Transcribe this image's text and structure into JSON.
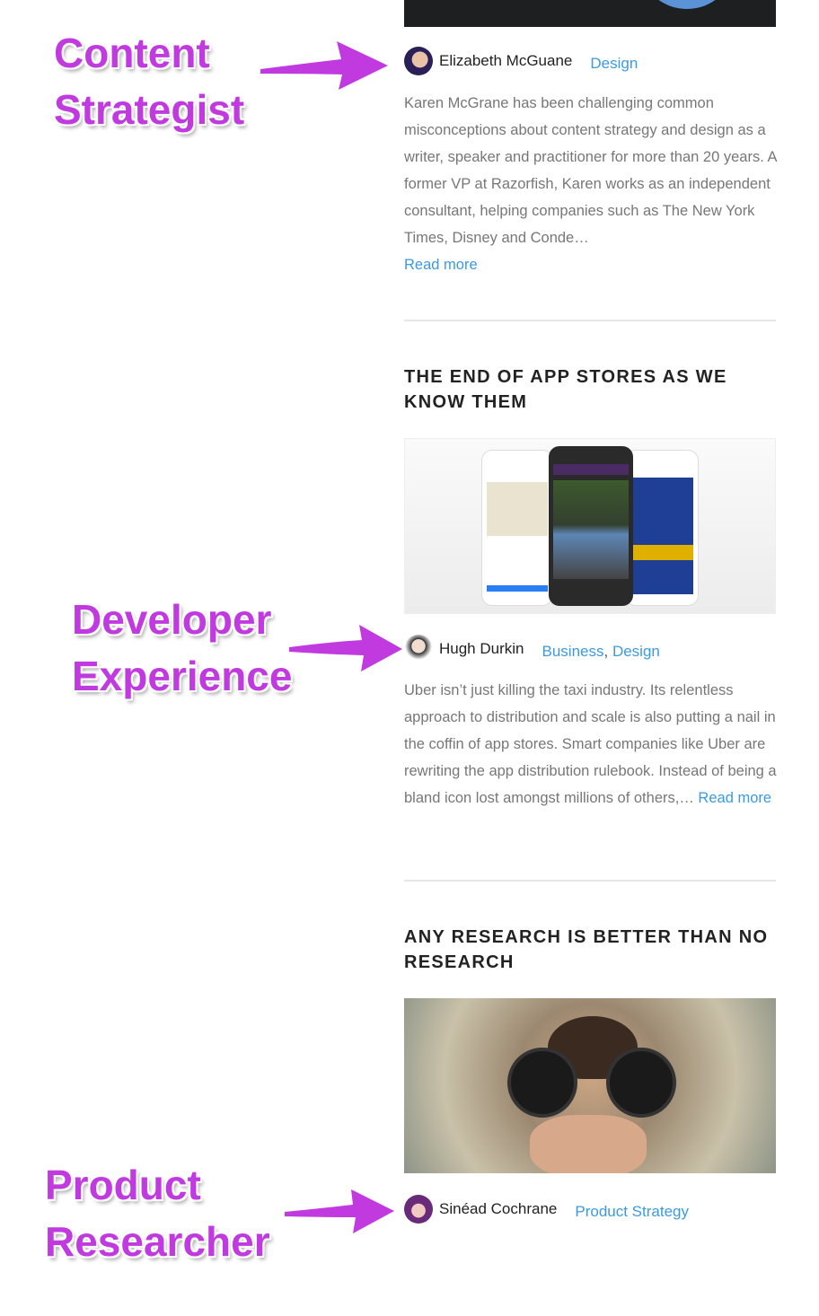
{
  "annotations": [
    {
      "line1": "Content",
      "line2": "Strategist"
    },
    {
      "line1": "Developer",
      "line2": "Experience"
    },
    {
      "line1": "Product",
      "line2": "Researcher"
    }
  ],
  "accent_color": "#c13ae0",
  "link_color": "#3b9ae1",
  "articles": [
    {
      "author": "Elizabeth McGuane",
      "categories": [
        "Design"
      ],
      "excerpt": "Karen McGrane has been challenging common misconceptions about content strategy and design as a writer, speaker and practitioner for more than 20 years. A former VP at Razorfish, Karen works as an independent consultant, helping companies such as The New York Times, Disney and Conde…",
      "read_more": "Read more"
    },
    {
      "title": "THE END OF APP STORES AS WE KNOW THEM",
      "author": "Hugh Durkin",
      "categories": [
        "Business",
        "Design"
      ],
      "excerpt": "Uber isn’t just killing the taxi industry. Its relentless approach to distribution and scale is also putting a nail in the coffin of app stores. Smart companies like Uber are rewriting the app distribution rulebook. Instead of being a bland icon lost amongst millions of others,…",
      "read_more": "Read more"
    },
    {
      "title": "ANY RESEARCH IS BETTER THAN NO RESEARCH",
      "author": "Sinéad Cochrane",
      "categories": [
        "Product Strategy"
      ]
    }
  ]
}
